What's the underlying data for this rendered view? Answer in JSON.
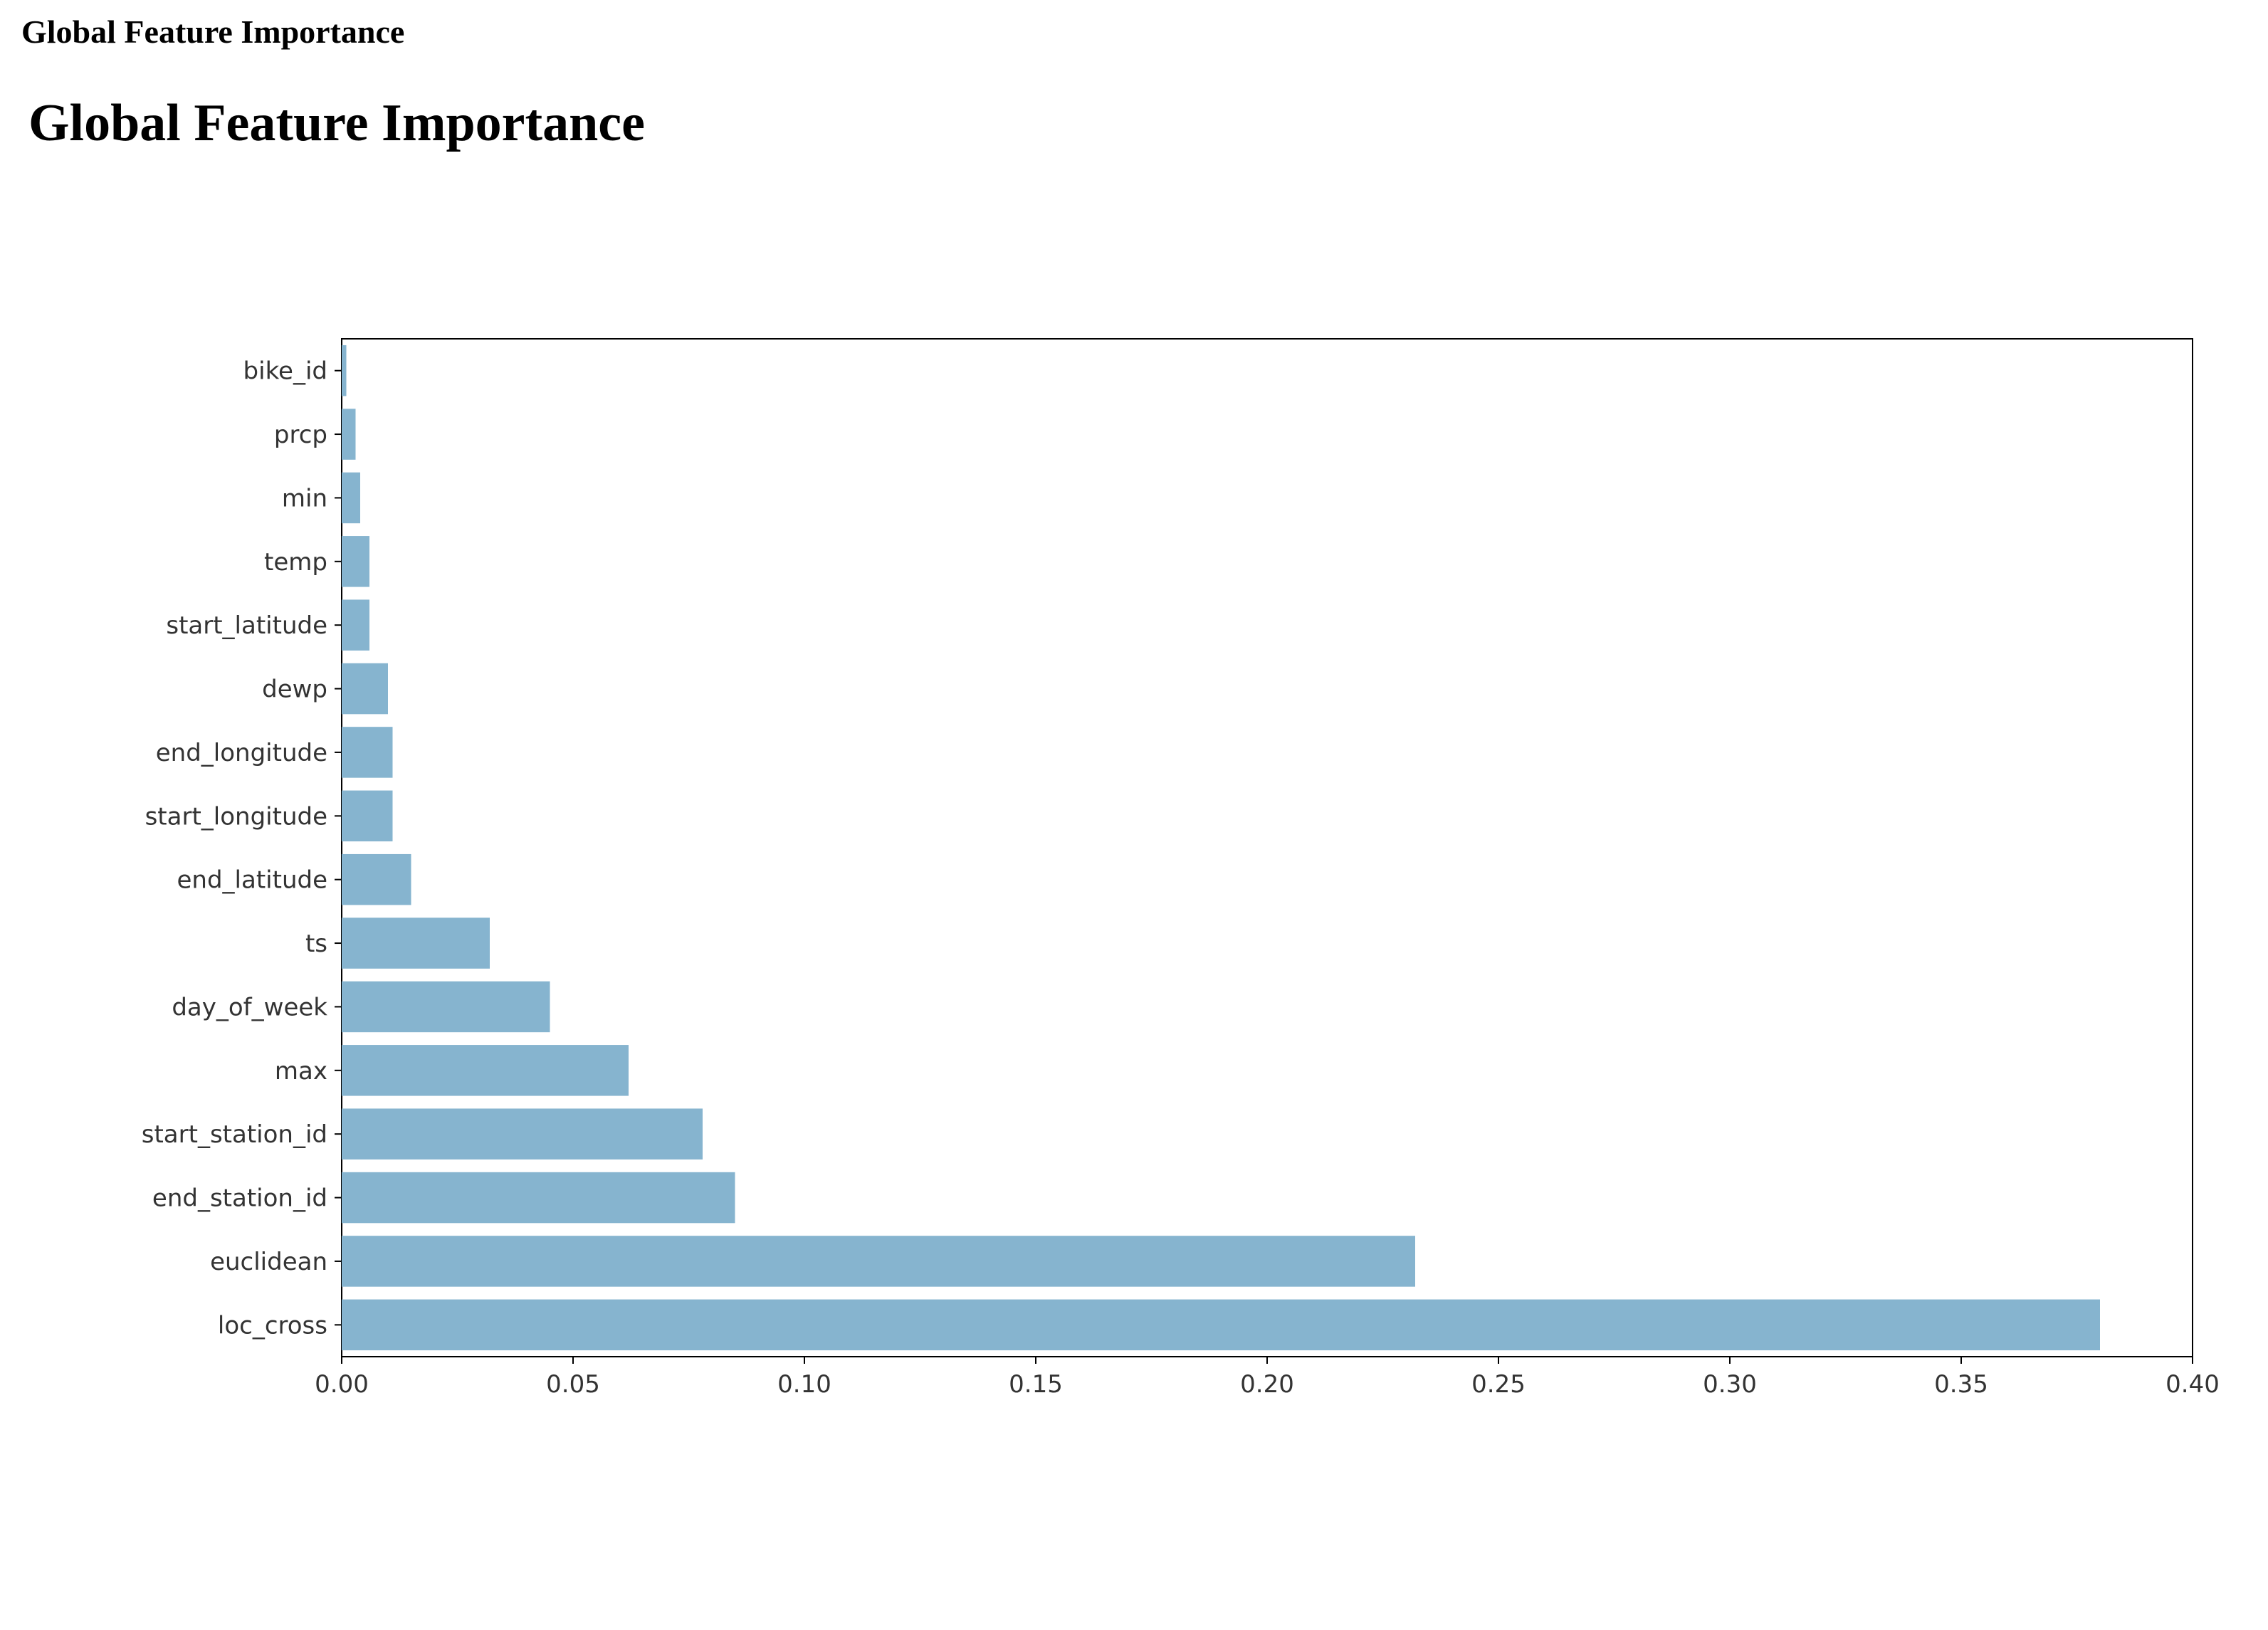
{
  "document": {
    "heading": "Global Feature Importance"
  },
  "chart_data": {
    "type": "bar",
    "orientation": "horizontal",
    "title": "Global Feature Importance",
    "xlabel": "",
    "ylabel": "",
    "xlim": [
      0.0,
      0.4
    ],
    "xticks": [
      0.0,
      0.05,
      0.1,
      0.15,
      0.2,
      0.25,
      0.3,
      0.35,
      0.4
    ],
    "xtick_labels": [
      "0.00",
      "0.05",
      "0.10",
      "0.15",
      "0.20",
      "0.25",
      "0.30",
      "0.35",
      "0.40"
    ],
    "categories": [
      "bike_id",
      "prcp",
      "min",
      "temp",
      "start_latitude",
      "dewp",
      "end_longitude",
      "start_longitude",
      "end_latitude",
      "ts",
      "day_of_week",
      "max",
      "start_station_id",
      "end_station_id",
      "euclidean",
      "loc_cross"
    ],
    "values": [
      0.001,
      0.003,
      0.004,
      0.006,
      0.006,
      0.01,
      0.011,
      0.011,
      0.015,
      0.032,
      0.045,
      0.062,
      0.078,
      0.085,
      0.232,
      0.38
    ],
    "bar_color": "#86b4cf"
  }
}
